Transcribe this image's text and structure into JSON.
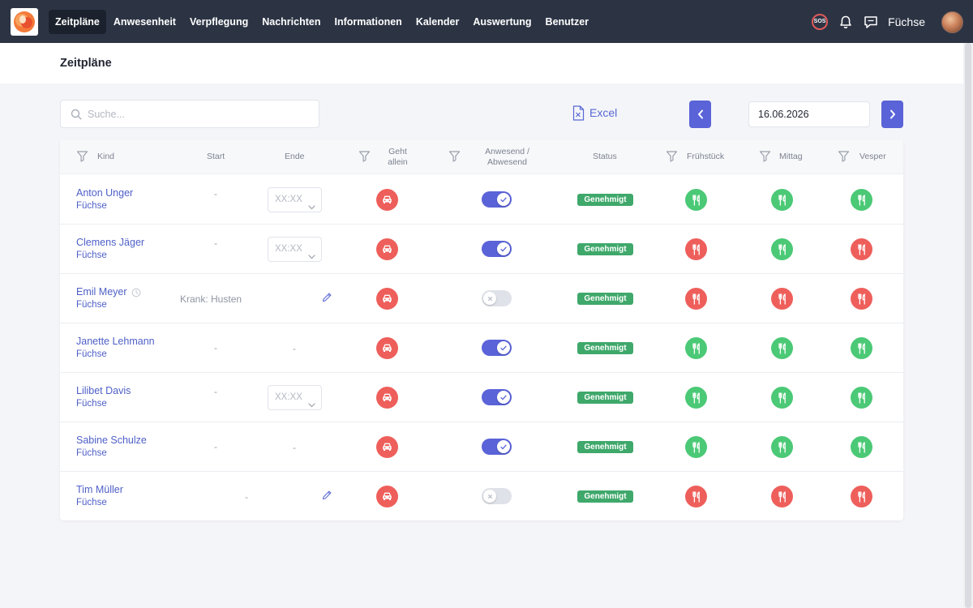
{
  "nav": {
    "items": [
      {
        "label": "Zeitpläne",
        "active": true
      },
      {
        "label": "Anwesenheit",
        "active": false
      },
      {
        "label": "Verpflegung",
        "active": false
      },
      {
        "label": "Nachrichten",
        "active": false
      },
      {
        "label": "Informationen",
        "active": false
      },
      {
        "label": "Kalender",
        "active": false
      },
      {
        "label": "Auswertung",
        "active": false
      },
      {
        "label": "Benutzer",
        "active": false
      }
    ],
    "sos_label": "SOS",
    "group_label": "Füchse"
  },
  "page": {
    "title": "Zeitpläne"
  },
  "toolbar": {
    "search_placeholder": "Suche...",
    "excel_label": "Excel",
    "date_value": "16.06.2026",
    "prev_label": "‹",
    "next_label": "›"
  },
  "table": {
    "headers": {
      "kind": "Kind",
      "start": "Start",
      "ende": "Ende",
      "geht_allein_1": "Geht",
      "geht_allein_2": "allein",
      "anwesend_1": "Anwesend /",
      "anwesend_2": "Abwesend",
      "status": "Status",
      "fruehstueck": "Frühstück",
      "mittag": "Mittag",
      "vesper": "Vesper"
    },
    "time_placeholder": "XX:XX",
    "dash": "-",
    "rows": [
      {
        "name": "Anton Unger",
        "group": "Füchse",
        "start": "-",
        "end_mode": "select",
        "present": true,
        "status": "Genehmigt",
        "breakfast": "green",
        "lunch": "green",
        "snack": "green"
      },
      {
        "name": "Clemens Jäger",
        "group": "Füchse",
        "start": "-",
        "end_mode": "select",
        "present": true,
        "status": "Genehmigt",
        "breakfast": "red",
        "lunch": "green",
        "snack": "red"
      },
      {
        "name": "Emil Meyer",
        "group": "Füchse",
        "reason": "Krank: Husten",
        "end_mode": "pencil",
        "present": false,
        "status": "Genehmigt",
        "breakfast": "red",
        "lunch": "red",
        "snack": "red",
        "has_clock": true
      },
      {
        "name": "Janette Lehmann",
        "group": "Füchse",
        "start": "-",
        "end": "-",
        "end_mode": "dash",
        "present": true,
        "status": "Genehmigt",
        "breakfast": "green",
        "lunch": "green",
        "snack": "green"
      },
      {
        "name": "Lilibet Davis",
        "group": "Füchse",
        "start": "-",
        "end_mode": "select",
        "present": true,
        "status": "Genehmigt",
        "breakfast": "green",
        "lunch": "green",
        "snack": "green"
      },
      {
        "name": "Sabine Schulze",
        "group": "Füchse",
        "start": "-",
        "end": "-",
        "end_mode": "dash",
        "present": true,
        "status": "Genehmigt",
        "breakfast": "green",
        "lunch": "green",
        "snack": "green"
      },
      {
        "name": "Tim Müller",
        "group": "Füchse",
        "start": "-",
        "end_mode": "pencil",
        "present": false,
        "status": "Genehmigt",
        "breakfast": "red",
        "lunch": "red",
        "snack": "red"
      }
    ]
  },
  "colors": {
    "accent": "#5a63d8",
    "red": "#ee5f5b",
    "green": "#4bc976",
    "badge": "#3fa86b",
    "topbar": "#2c3444"
  }
}
